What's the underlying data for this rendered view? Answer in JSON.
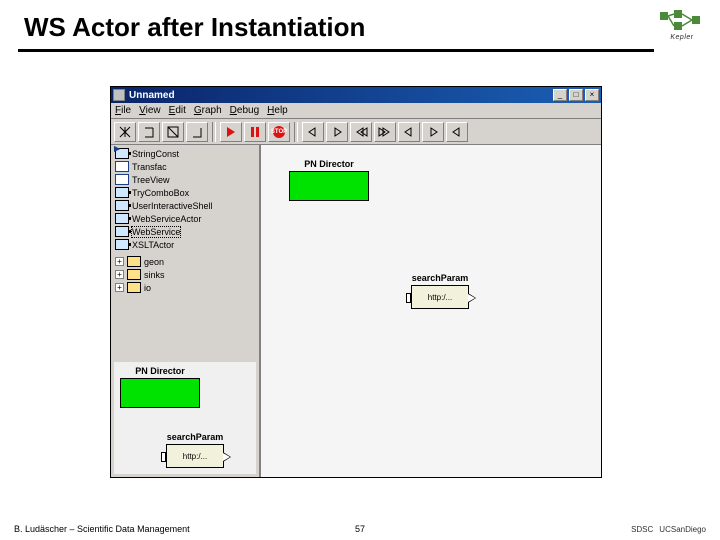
{
  "slide": {
    "title": "WS Actor after Instantiation",
    "footer_credit": "B. Ludäscher – Scientific Data Management",
    "page_number": "57",
    "header_logo_label": "Kepler",
    "footer_logos": [
      "SDSC",
      "UCSanDiego"
    ]
  },
  "window": {
    "title": "Unnamed",
    "control_min": "_",
    "control_max": "□",
    "control_close": "×",
    "menus": {
      "file": "File",
      "view": "View",
      "edit": "Edit",
      "graph": "Graph",
      "debug": "Debug",
      "help": "Help"
    },
    "toolbar": {
      "stop_label": "STOP"
    },
    "tree": {
      "items": [
        "StringConst",
        "Transfac",
        "TreeView",
        "TryComboBox",
        "UserInteractiveShell",
        "WebServiceActor",
        "WebService",
        "XSLTActor"
      ],
      "selected_index": 6,
      "folders": [
        "geon",
        "sinks",
        "io"
      ]
    },
    "sidebar_preview": {
      "director_label": "PN Director",
      "search_label": "searchParam",
      "search_value": "http:/..."
    },
    "canvas": {
      "director_label": "PN Director",
      "search_label": "searchParam",
      "search_value": "http:/..."
    }
  }
}
